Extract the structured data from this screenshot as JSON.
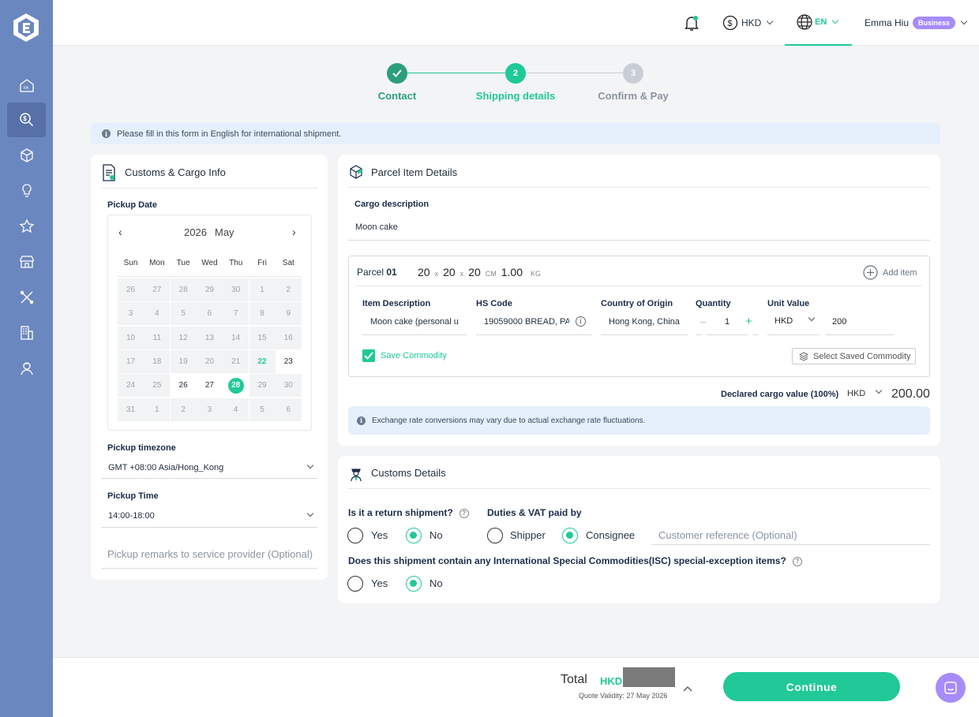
{
  "header": {
    "currency": "HKD",
    "language": "EN",
    "user_name": "Emma Hiu",
    "user_badge": "Business"
  },
  "steps": [
    {
      "label": "Contact",
      "number": "1",
      "state": "done"
    },
    {
      "label": "Shipping details",
      "number": "2",
      "state": "active"
    },
    {
      "label": "Confirm & Pay",
      "number": "3",
      "state": "pending"
    }
  ],
  "notice": "Please fill in this form in English for international shipment.",
  "customs_cargo": {
    "title": "Customs & Cargo Info",
    "pickup_date_label": "Pickup Date",
    "calendar": {
      "year": "2026",
      "month": "May",
      "prev": "‹",
      "next": "›",
      "weekdays": [
        "Sun",
        "Mon",
        "Tue",
        "Wed",
        "Thu",
        "Fri",
        "Sat"
      ],
      "rows": [
        [
          "26",
          "27",
          "28",
          "29",
          "30",
          "1",
          "2"
        ],
        [
          "3",
          "4",
          "5",
          "6",
          "7",
          "8",
          "9"
        ],
        [
          "10",
          "11",
          "12",
          "13",
          "14",
          "15",
          "16"
        ],
        [
          "17",
          "18",
          "19",
          "20",
          "21",
          "22",
          "23"
        ],
        [
          "24",
          "25",
          "26",
          "27",
          "28",
          "29",
          "30"
        ],
        [
          "31",
          "1",
          "2",
          "3",
          "4",
          "5",
          "6"
        ]
      ],
      "enabled_days": [
        "23",
        "26",
        "27"
      ],
      "today": "22",
      "selected": "28"
    },
    "timezone_label": "Pickup timezone",
    "timezone_value": "GMT +08:00 Asia/Hong_Kong",
    "time_label": "Pickup Time",
    "time_value": "14:00-18:00",
    "remarks_placeholder": "Pickup remarks to service provider (Optional)"
  },
  "parcel": {
    "title": "Parcel Item Details",
    "cargo_desc_label": "Cargo description",
    "cargo_desc_value": "Moon cake",
    "parcel_label": "Parcel",
    "parcel_no": "01",
    "dim_l": "20",
    "dim_w": "20",
    "dim_h": "20",
    "times": "x",
    "dim_unit": "CM",
    "weight": "1.00",
    "weight_unit": "KG",
    "add_item": "Add item",
    "item_desc_label": "Item Description",
    "item_desc_value": "Moon cake (personal u",
    "hs_code_label": "HS Code",
    "hs_code_value": "19059000 BREAD, PA",
    "origin_label": "Country of Origin",
    "origin_value": "Hong Kong, China",
    "quantity_label": "Quantity",
    "quantity_value": "1",
    "qty_minus": "–",
    "qty_plus": "+",
    "unit_value_label": "Unit Value",
    "unit_currency": "HKD",
    "unit_value": "200",
    "save_commodity": "Save Commodity",
    "select_saved": "Select Saved Commodity",
    "declared_label": "Declared cargo value (100%)",
    "declared_currency": "HKD",
    "declared_value": "200.00",
    "exchange_notice": "Exchange rate conversions may vary due to actual exchange rate fluctuations."
  },
  "customs": {
    "title": "Customs Details",
    "return_q": "Is it a return shipment?",
    "yes": "Yes",
    "no": "No",
    "return_value": "No",
    "duties_q": "Duties & VAT paid by",
    "shipper": "Shipper",
    "consignee": "Consignee",
    "duties_value": "Consignee",
    "customer_ref_placeholder": "Customer reference (Optional)",
    "isc_q": "Does this shipment contain any International Special Commodities(ISC) special-exception items?",
    "isc_value": "No"
  },
  "footer": {
    "total_label": "Total",
    "total_currency": "HKD",
    "quote_validity": "Quote Validity: 27 May 2026",
    "continue": "Continue"
  },
  "colors": {
    "accent": "#20c997",
    "sidebar": "#6b87bf",
    "badge": "#a78bfa",
    "notice_bg": "#e5f0fc"
  }
}
